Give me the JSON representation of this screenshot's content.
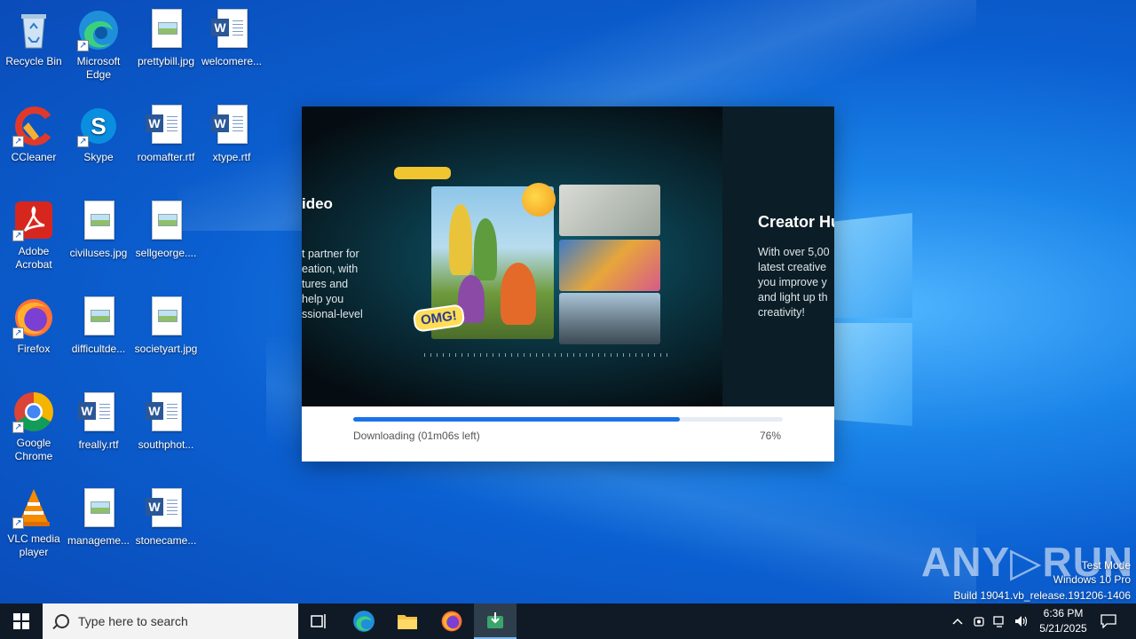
{
  "desktop": {
    "icons": [
      {
        "label": "Recycle Bin"
      },
      {
        "label": "Microsoft Edge"
      },
      {
        "label": "prettybill.jpg"
      },
      {
        "label": "welcomere..."
      },
      {
        "label": "CCleaner"
      },
      {
        "label": "Skype"
      },
      {
        "label": "roomafter.rtf"
      },
      {
        "label": "xtype.rtf"
      },
      {
        "label": "Adobe Acrobat"
      },
      {
        "label": "civiluses.jpg"
      },
      {
        "label": "sellgeorge...."
      },
      {
        "label": "Firefox"
      },
      {
        "label": "difficultde..."
      },
      {
        "label": "societyart.jpg"
      },
      {
        "label": "Google Chrome"
      },
      {
        "label": "freally.rtf"
      },
      {
        "label": "southphot..."
      },
      {
        "label": "VLC media player"
      },
      {
        "label": "manageme..."
      },
      {
        "label": "stonecame..."
      }
    ]
  },
  "installer": {
    "slide_left": {
      "title": "ideo",
      "text": "t partner for\neation, with\ntures and\nhelp you\nssional-level"
    },
    "slide_right": {
      "title": "Creator Hu",
      "text": "With over 5,00\nlatest creative\nyou improve y\nand light up th\ncreativity!"
    },
    "sticker": "OMG!",
    "status": "Downloading (01m06s left)",
    "percent_label": "76%",
    "progress_fraction": 0.76
  },
  "watermark": {
    "brand": "ANY RUN",
    "line1": "Test Mode",
    "line2": "Windows 10 Pro",
    "line3": "Build 19041.vb_release.191206-1406"
  },
  "taskbar": {
    "search_placeholder": "Type here to search",
    "time": "6:36 PM",
    "date": "5/21/2025"
  }
}
